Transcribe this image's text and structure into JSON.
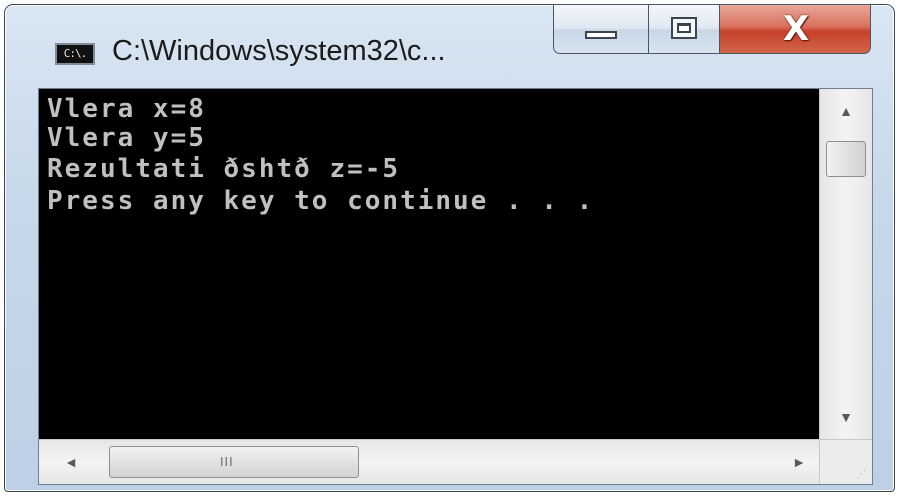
{
  "window": {
    "title": "C:\\Windows\\system32\\c...",
    "icon_label": "C:\\."
  },
  "caption_buttons": {
    "minimize": "minimize-icon",
    "maximize": "maximize-icon",
    "close": "close-icon",
    "close_glyph": "X"
  },
  "console": {
    "lines": [
      "Vlera x=8",
      "Vlera y=5",
      "Rezultati ðshtð z=-5",
      "Press any key to continue . . ."
    ],
    "background": "#000000",
    "foreground": "#c0c0c0"
  },
  "scrollbars": {
    "vertical_up": "▲",
    "vertical_down": "▼",
    "horizontal_left": "◄",
    "horizontal_right": "►",
    "thumb_grip": "III"
  }
}
